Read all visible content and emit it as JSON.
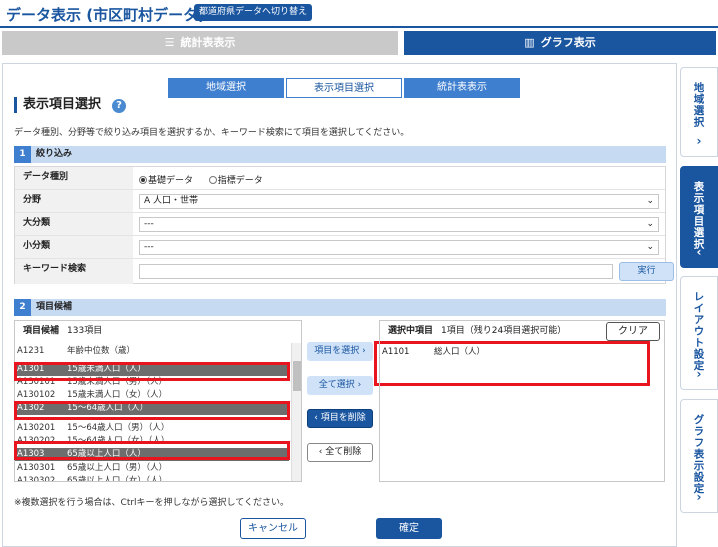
{
  "header": {
    "title": "データ表示 (市区町村データ)",
    "switch_label": "都道府県データへ切り替え"
  },
  "mode_tabs": {
    "stat_label": "統計表表示",
    "graph_label": "グラフ表示"
  },
  "steps": [
    "地域選択",
    "表示項目選択",
    "統計表表示"
  ],
  "section": {
    "title": "表示項目選択",
    "help": "?",
    "instruction": "データ種別、分野等で絞り込み項目を選択するか、キーワード検索にて項目を選択してください。"
  },
  "filter": {
    "band_num": "1",
    "band_label": "絞り込み",
    "rows": {
      "datatype_label": "データ種別",
      "radio_basic": "基礎データ",
      "radio_index": "指標データ",
      "field_label": "分野",
      "field_value": "A 人口・世帯",
      "major_label": "大分類",
      "major_value": "---",
      "minor_label": "小分類",
      "minor_value": "---",
      "keyword_label": "キーワード検索",
      "run_label": "実行"
    }
  },
  "candidates": {
    "band_num": "2",
    "band_label": "項目候補",
    "head_label": "項目候補",
    "count": "133項目",
    "items": [
      {
        "code": "A1231",
        "name": "年齢中位数（歳）",
        "selected": false
      },
      {
        "code": "A1301",
        "name": "15歳未満人口（人）",
        "selected": true
      },
      {
        "code": "A130101",
        "name": "15歳未満人口（男）（人）",
        "selected": false
      },
      {
        "code": "A130102",
        "name": "15歳未満人口（女）（人）",
        "selected": false
      },
      {
        "code": "A1302",
        "name": "15～64歳人口（人）",
        "selected": true
      },
      {
        "code": "A130201",
        "name": "15～64歳人口（男）（人）",
        "selected": false
      },
      {
        "code": "A130202",
        "name": "15～64歳人口（女）（人）",
        "selected": false
      },
      {
        "code": "A1303",
        "name": "65歳以上人口（人）",
        "selected": true
      },
      {
        "code": "A130301",
        "name": "65歳以上人口（男）（人）",
        "selected": false
      },
      {
        "code": "A130302",
        "name": "65歳以上人口（女）（人）",
        "selected": false
      }
    ]
  },
  "middle_buttons": {
    "add": "項目を選択 ›",
    "add_all": "全て選択 ›",
    "remove": "‹ 項目を削除",
    "remove_all": "‹ 全て削除"
  },
  "selected": {
    "head_label": "選択中項目",
    "count": "1項目（残り24項目選択可能）",
    "clear_label": "クリア",
    "items": [
      {
        "code": "A1101",
        "name": "総人口（人）"
      }
    ]
  },
  "footer": {
    "note": "※複数選択を行う場合は、Ctrlキーを押しながら選択してください。",
    "cancel": "キャンセル",
    "ok": "確定"
  },
  "side_tabs": [
    {
      "label": "地域選択",
      "arrow": "›",
      "active": false
    },
    {
      "label": "表示項目選択",
      "arrow": "‹",
      "active": true
    },
    {
      "label": "レイアウト設定",
      "arrow": "›",
      "active": false
    },
    {
      "label": "グラフ表示設定",
      "arrow": "›",
      "active": false
    }
  ],
  "colors": {
    "primary": "#1a56a0",
    "highlight": "#e8141e"
  }
}
